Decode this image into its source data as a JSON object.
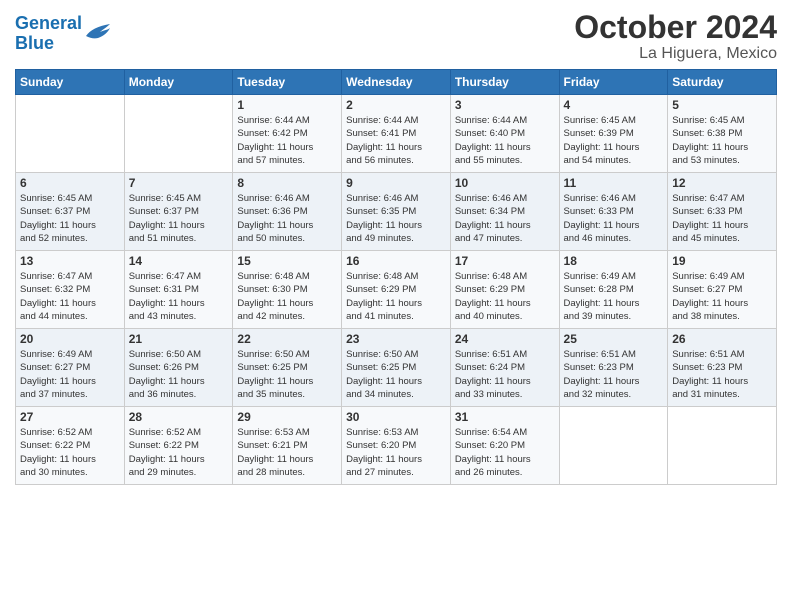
{
  "header": {
    "logo_line1": "General",
    "logo_line2": "Blue",
    "month": "October 2024",
    "location": "La Higuera, Mexico"
  },
  "weekdays": [
    "Sunday",
    "Monday",
    "Tuesday",
    "Wednesday",
    "Thursday",
    "Friday",
    "Saturday"
  ],
  "weeks": [
    [
      {
        "day": "",
        "info": ""
      },
      {
        "day": "",
        "info": ""
      },
      {
        "day": "1",
        "info": "Sunrise: 6:44 AM\nSunset: 6:42 PM\nDaylight: 11 hours\nand 57 minutes."
      },
      {
        "day": "2",
        "info": "Sunrise: 6:44 AM\nSunset: 6:41 PM\nDaylight: 11 hours\nand 56 minutes."
      },
      {
        "day": "3",
        "info": "Sunrise: 6:44 AM\nSunset: 6:40 PM\nDaylight: 11 hours\nand 55 minutes."
      },
      {
        "day": "4",
        "info": "Sunrise: 6:45 AM\nSunset: 6:39 PM\nDaylight: 11 hours\nand 54 minutes."
      },
      {
        "day": "5",
        "info": "Sunrise: 6:45 AM\nSunset: 6:38 PM\nDaylight: 11 hours\nand 53 minutes."
      }
    ],
    [
      {
        "day": "6",
        "info": "Sunrise: 6:45 AM\nSunset: 6:37 PM\nDaylight: 11 hours\nand 52 minutes."
      },
      {
        "day": "7",
        "info": "Sunrise: 6:45 AM\nSunset: 6:37 PM\nDaylight: 11 hours\nand 51 minutes."
      },
      {
        "day": "8",
        "info": "Sunrise: 6:46 AM\nSunset: 6:36 PM\nDaylight: 11 hours\nand 50 minutes."
      },
      {
        "day": "9",
        "info": "Sunrise: 6:46 AM\nSunset: 6:35 PM\nDaylight: 11 hours\nand 49 minutes."
      },
      {
        "day": "10",
        "info": "Sunrise: 6:46 AM\nSunset: 6:34 PM\nDaylight: 11 hours\nand 47 minutes."
      },
      {
        "day": "11",
        "info": "Sunrise: 6:46 AM\nSunset: 6:33 PM\nDaylight: 11 hours\nand 46 minutes."
      },
      {
        "day": "12",
        "info": "Sunrise: 6:47 AM\nSunset: 6:33 PM\nDaylight: 11 hours\nand 45 minutes."
      }
    ],
    [
      {
        "day": "13",
        "info": "Sunrise: 6:47 AM\nSunset: 6:32 PM\nDaylight: 11 hours\nand 44 minutes."
      },
      {
        "day": "14",
        "info": "Sunrise: 6:47 AM\nSunset: 6:31 PM\nDaylight: 11 hours\nand 43 minutes."
      },
      {
        "day": "15",
        "info": "Sunrise: 6:48 AM\nSunset: 6:30 PM\nDaylight: 11 hours\nand 42 minutes."
      },
      {
        "day": "16",
        "info": "Sunrise: 6:48 AM\nSunset: 6:29 PM\nDaylight: 11 hours\nand 41 minutes."
      },
      {
        "day": "17",
        "info": "Sunrise: 6:48 AM\nSunset: 6:29 PM\nDaylight: 11 hours\nand 40 minutes."
      },
      {
        "day": "18",
        "info": "Sunrise: 6:49 AM\nSunset: 6:28 PM\nDaylight: 11 hours\nand 39 minutes."
      },
      {
        "day": "19",
        "info": "Sunrise: 6:49 AM\nSunset: 6:27 PM\nDaylight: 11 hours\nand 38 minutes."
      }
    ],
    [
      {
        "day": "20",
        "info": "Sunrise: 6:49 AM\nSunset: 6:27 PM\nDaylight: 11 hours\nand 37 minutes."
      },
      {
        "day": "21",
        "info": "Sunrise: 6:50 AM\nSunset: 6:26 PM\nDaylight: 11 hours\nand 36 minutes."
      },
      {
        "day": "22",
        "info": "Sunrise: 6:50 AM\nSunset: 6:25 PM\nDaylight: 11 hours\nand 35 minutes."
      },
      {
        "day": "23",
        "info": "Sunrise: 6:50 AM\nSunset: 6:25 PM\nDaylight: 11 hours\nand 34 minutes."
      },
      {
        "day": "24",
        "info": "Sunrise: 6:51 AM\nSunset: 6:24 PM\nDaylight: 11 hours\nand 33 minutes."
      },
      {
        "day": "25",
        "info": "Sunrise: 6:51 AM\nSunset: 6:23 PM\nDaylight: 11 hours\nand 32 minutes."
      },
      {
        "day": "26",
        "info": "Sunrise: 6:51 AM\nSunset: 6:23 PM\nDaylight: 11 hours\nand 31 minutes."
      }
    ],
    [
      {
        "day": "27",
        "info": "Sunrise: 6:52 AM\nSunset: 6:22 PM\nDaylight: 11 hours\nand 30 minutes."
      },
      {
        "day": "28",
        "info": "Sunrise: 6:52 AM\nSunset: 6:22 PM\nDaylight: 11 hours\nand 29 minutes."
      },
      {
        "day": "29",
        "info": "Sunrise: 6:53 AM\nSunset: 6:21 PM\nDaylight: 11 hours\nand 28 minutes."
      },
      {
        "day": "30",
        "info": "Sunrise: 6:53 AM\nSunset: 6:20 PM\nDaylight: 11 hours\nand 27 minutes."
      },
      {
        "day": "31",
        "info": "Sunrise: 6:54 AM\nSunset: 6:20 PM\nDaylight: 11 hours\nand 26 minutes."
      },
      {
        "day": "",
        "info": ""
      },
      {
        "day": "",
        "info": ""
      }
    ]
  ]
}
